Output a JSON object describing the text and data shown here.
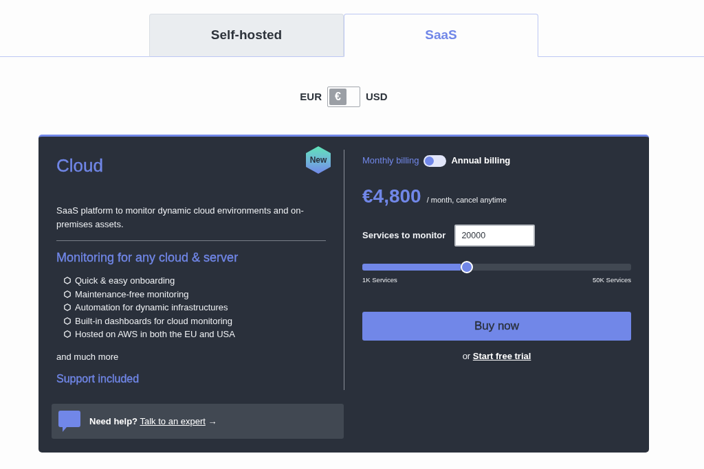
{
  "tabs": [
    {
      "label": "Self-hosted",
      "selected": false
    },
    {
      "label": "SaaS",
      "selected": true
    }
  ],
  "currency": {
    "left_label": "EUR",
    "right_label": "USD",
    "symbol": "€",
    "switch_on": false
  },
  "plan": {
    "title": "Cloud",
    "badge": "New",
    "description": "SaaS platform to monitor dynamic cloud environments and on-premises assets.",
    "features_heading": "Monitoring for any cloud & server",
    "features": [
      "Quick & easy onboarding",
      "Maintenance-free monitoring",
      "Automation for dynamic infrastructures",
      "Built-in dashboards for cloud monitoring",
      "Hosted on AWS in both the EU and USA"
    ],
    "more": "and much more",
    "support": "Support included",
    "help": {
      "prefix": "Need help?",
      "link": "Talk to an expert",
      "arrow": "→"
    }
  },
  "billing": {
    "left_label": "Monthly billing",
    "right_label": "Annual billing",
    "switch_on": false
  },
  "price": {
    "amount": "€4,800",
    "period": "/ month, cancel anytime"
  },
  "services": {
    "label": "Services to monitor",
    "value": "20000"
  },
  "slider": {
    "level": 0.39,
    "min_label": "1K Services",
    "max_label": "50K Services"
  },
  "buy_button": "Buy now",
  "trial": {
    "prefix": "or",
    "link": "Start free trial"
  }
}
